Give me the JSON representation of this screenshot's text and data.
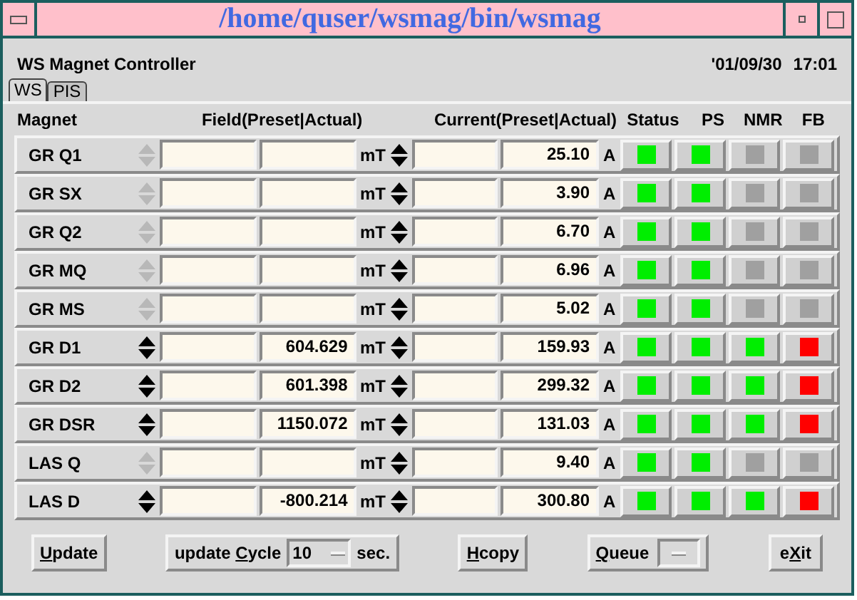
{
  "window": {
    "title": "/home/quser/wsmag/bin/wsmag"
  },
  "header": {
    "app_name": "WS Magnet Controller",
    "date": "'01/09/30",
    "time": "17:01"
  },
  "tabs": [
    {
      "label": "WS",
      "selected": true
    },
    {
      "label": "PIS",
      "selected": false
    }
  ],
  "columns": {
    "magnet": "Magnet",
    "field": "Field(Preset|Actual)",
    "current": "Current(Preset|Actual)",
    "status": "Status",
    "ps": "PS",
    "nmr": "NMR",
    "fb": "FB"
  },
  "rows": [
    {
      "name": "GR Q1",
      "field_enabled": false,
      "field_unit": "mT",
      "current_actual": "25.10",
      "current_unit": "A",
      "indicators": [
        {
          "color": "#00ee00"
        },
        {
          "color": "#00ee00"
        },
        {
          "color": "#a0a0a0"
        },
        {
          "color": "#a0a0a0"
        }
      ]
    },
    {
      "name": "GR SX",
      "field_enabled": false,
      "field_unit": "mT",
      "current_actual": "3.90",
      "current_unit": "A",
      "indicators": [
        {
          "color": "#00ee00"
        },
        {
          "color": "#00ee00"
        },
        {
          "color": "#a0a0a0"
        },
        {
          "color": "#a0a0a0"
        }
      ]
    },
    {
      "name": "GR Q2",
      "field_enabled": false,
      "field_unit": "mT",
      "current_actual": "6.70",
      "current_unit": "A",
      "indicators": [
        {
          "color": "#00ee00"
        },
        {
          "color": "#00ee00"
        },
        {
          "color": "#a0a0a0"
        },
        {
          "color": "#a0a0a0"
        }
      ]
    },
    {
      "name": "GR MQ",
      "field_enabled": false,
      "field_unit": "mT",
      "current_actual": "6.96",
      "current_unit": "A",
      "indicators": [
        {
          "color": "#00ee00"
        },
        {
          "color": "#00ee00"
        },
        {
          "color": "#a0a0a0"
        },
        {
          "color": "#a0a0a0"
        }
      ]
    },
    {
      "name": "GR MS",
      "field_enabled": false,
      "field_unit": "mT",
      "current_actual": "5.02",
      "current_unit": "A",
      "indicators": [
        {
          "color": "#00ee00"
        },
        {
          "color": "#00ee00"
        },
        {
          "color": "#a0a0a0"
        },
        {
          "color": "#a0a0a0"
        }
      ]
    },
    {
      "name": "GR D1",
      "field_enabled": true,
      "field_actual": "604.629",
      "field_unit": "mT",
      "current_actual": "159.93",
      "current_unit": "A",
      "indicators": [
        {
          "color": "#00ee00"
        },
        {
          "color": "#00ee00"
        },
        {
          "color": "#00ee00"
        },
        {
          "color": "#ff0000"
        }
      ]
    },
    {
      "name": "GR D2",
      "field_enabled": true,
      "field_actual": "601.398",
      "field_unit": "mT",
      "current_actual": "299.32",
      "current_unit": "A",
      "indicators": [
        {
          "color": "#00ee00"
        },
        {
          "color": "#00ee00"
        },
        {
          "color": "#00ee00"
        },
        {
          "color": "#ff0000"
        }
      ]
    },
    {
      "name": "GR DSR",
      "field_enabled": true,
      "field_actual": "1150.072",
      "field_unit": "mT",
      "current_actual": "131.03",
      "current_unit": "A",
      "indicators": [
        {
          "color": "#00ee00"
        },
        {
          "color": "#00ee00"
        },
        {
          "color": "#00ee00"
        },
        {
          "color": "#ff0000"
        }
      ]
    },
    {
      "name": "LAS Q",
      "field_enabled": false,
      "field_unit": "mT",
      "current_actual": "9.40",
      "current_unit": "A",
      "indicators": [
        {
          "color": "#00ee00"
        },
        {
          "color": "#00ee00"
        },
        {
          "color": "#a0a0a0"
        },
        {
          "color": "#a0a0a0"
        }
      ]
    },
    {
      "name": "LAS D",
      "field_enabled": true,
      "field_actual": "-800.214",
      "field_unit": "mT",
      "current_actual": "300.80",
      "current_unit": "A",
      "indicators": [
        {
          "color": "#00ee00"
        },
        {
          "color": "#00ee00"
        },
        {
          "color": "#00ee00"
        },
        {
          "color": "#ff0000"
        }
      ]
    }
  ],
  "footer": {
    "update_button": {
      "accel": "U",
      "after": "pdate"
    },
    "cycle": {
      "before": "update ",
      "accel": "C",
      "after": "ycle",
      "value": "10",
      "unit": "sec."
    },
    "hcopy_button": {
      "accel": "H",
      "after": "copy"
    },
    "queue": {
      "accel": "Q",
      "after": "ueue"
    },
    "exit_button": {
      "before": "e",
      "accel": "X",
      "after": "it"
    }
  }
}
